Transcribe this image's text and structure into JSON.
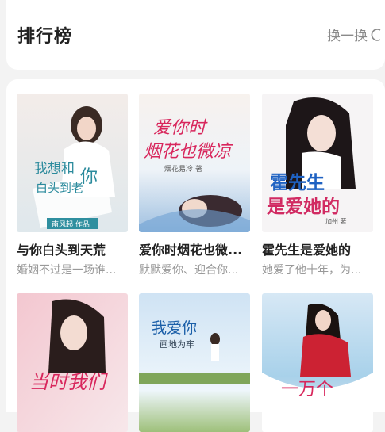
{
  "header": {
    "title": "排行榜",
    "swap_label": "换一换"
  },
  "books": [
    {
      "title": "与你白头到天荒",
      "desc": "婚姻不过是一场谁...",
      "cover_title": "我想和你白头到老",
      "cover_author": "南风起 作品"
    },
    {
      "title": "爱你时烟花也微...",
      "desc": "默默爱你、迎合你...",
      "cover_title": "爱你时烟花也微凉",
      "cover_author": "烟花易冷 著"
    },
    {
      "title": "霍先生是爱她的",
      "desc": "她爱了他十年，为...",
      "cover_title": "霍先生是爱她的",
      "cover_author": "加州 著"
    },
    {
      "title": "",
      "desc": "",
      "cover_title": "当时我们"
    },
    {
      "title": "",
      "desc": "",
      "cover_title": "我爱你画地为牢"
    },
    {
      "title": "",
      "desc": "",
      "cover_title": "一万个"
    }
  ],
  "colors": {
    "title_text": "#222222",
    "muted_text": "#999999",
    "cover_accent_pink": "#e0306a"
  }
}
